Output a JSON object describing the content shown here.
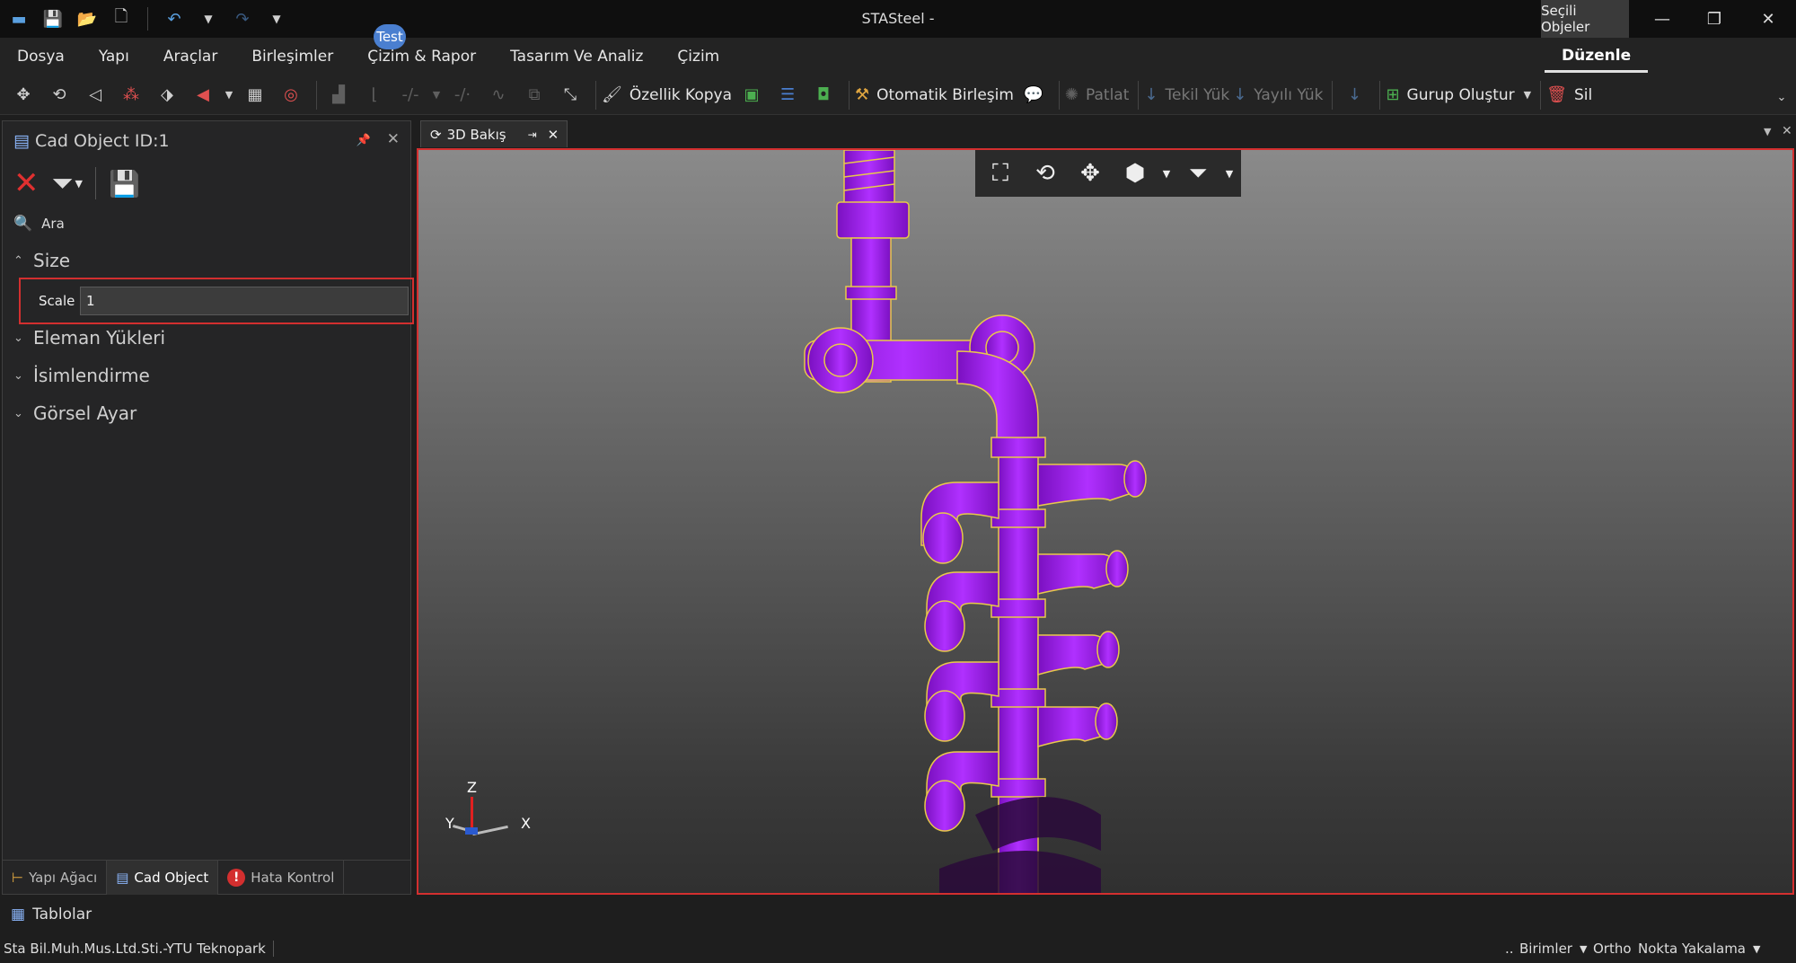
{
  "window": {
    "title": "STASteel -",
    "selected_objects": "Seçili Objeler"
  },
  "badge": "Test",
  "menu": {
    "items": [
      "Dosya",
      "Yapı",
      "Araçlar",
      "Birleşimler",
      "Çizim & Rapor",
      "Tasarım Ve Analiz",
      "Çizim"
    ],
    "active": "Düzenle"
  },
  "toolbar": {
    "ozellik_kopya": "Özellik Kopya",
    "otomatik_birlesim": "Otomatik Birleşim",
    "patlat": "Patlat",
    "tekil_yuk": "Tekil Yük",
    "yayili_yuk": "Yayılı Yük",
    "gurup_olustur": "Gurup Oluştur",
    "sil": "Sil"
  },
  "panel": {
    "title": "Cad Object ID:1",
    "search_placeholder": "Ara",
    "categories": {
      "size": "Size",
      "eleman": "Eleman Yükleri",
      "isim": "İsimlendirme",
      "gorsel": "Görsel Ayar"
    },
    "scale_label": "Scale",
    "scale_value": "1",
    "tabs": {
      "yapi": "Yapı Ağacı",
      "cad": "Cad Object",
      "hata": "Hata Kontrol"
    }
  },
  "document_tab": "3D Bakış",
  "axes": {
    "x": "X",
    "y": "Y",
    "z": "Z"
  },
  "status": {
    "tablolar": "Tablolar",
    "company": "Sta Bil.Muh.Mus.Ltd.Sti.-YTU Teknopark",
    "units_prefix": "..",
    "units": "Birimler",
    "ortho": "Ortho",
    "snap": "Nokta Yakalama"
  },
  "colors": {
    "accent_red": "#d32f2f",
    "pipe": "#a020f0",
    "edge": "#e8c84a",
    "badge": "#4a7fd0"
  }
}
